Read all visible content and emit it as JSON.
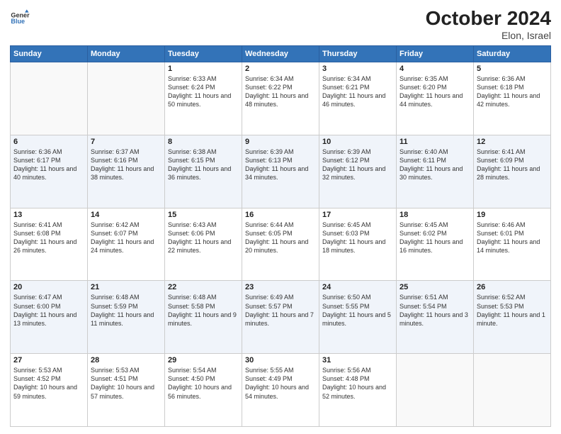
{
  "header": {
    "logo_line1": "General",
    "logo_line2": "Blue",
    "month_year": "October 2024",
    "location": "Elon, Israel"
  },
  "weekdays": [
    "Sunday",
    "Monday",
    "Tuesday",
    "Wednesday",
    "Thursday",
    "Friday",
    "Saturday"
  ],
  "rows": [
    {
      "cells": [
        {
          "day": "",
          "info": ""
        },
        {
          "day": "",
          "info": ""
        },
        {
          "day": "1",
          "info": "Sunrise: 6:33 AM\nSunset: 6:24 PM\nDaylight: 11 hours and 50 minutes."
        },
        {
          "day": "2",
          "info": "Sunrise: 6:34 AM\nSunset: 6:22 PM\nDaylight: 11 hours and 48 minutes."
        },
        {
          "day": "3",
          "info": "Sunrise: 6:34 AM\nSunset: 6:21 PM\nDaylight: 11 hours and 46 minutes."
        },
        {
          "day": "4",
          "info": "Sunrise: 6:35 AM\nSunset: 6:20 PM\nDaylight: 11 hours and 44 minutes."
        },
        {
          "day": "5",
          "info": "Sunrise: 6:36 AM\nSunset: 6:18 PM\nDaylight: 11 hours and 42 minutes."
        }
      ]
    },
    {
      "cells": [
        {
          "day": "6",
          "info": "Sunrise: 6:36 AM\nSunset: 6:17 PM\nDaylight: 11 hours and 40 minutes."
        },
        {
          "day": "7",
          "info": "Sunrise: 6:37 AM\nSunset: 6:16 PM\nDaylight: 11 hours and 38 minutes."
        },
        {
          "day": "8",
          "info": "Sunrise: 6:38 AM\nSunset: 6:15 PM\nDaylight: 11 hours and 36 minutes."
        },
        {
          "day": "9",
          "info": "Sunrise: 6:39 AM\nSunset: 6:13 PM\nDaylight: 11 hours and 34 minutes."
        },
        {
          "day": "10",
          "info": "Sunrise: 6:39 AM\nSunset: 6:12 PM\nDaylight: 11 hours and 32 minutes."
        },
        {
          "day": "11",
          "info": "Sunrise: 6:40 AM\nSunset: 6:11 PM\nDaylight: 11 hours and 30 minutes."
        },
        {
          "day": "12",
          "info": "Sunrise: 6:41 AM\nSunset: 6:09 PM\nDaylight: 11 hours and 28 minutes."
        }
      ]
    },
    {
      "cells": [
        {
          "day": "13",
          "info": "Sunrise: 6:41 AM\nSunset: 6:08 PM\nDaylight: 11 hours and 26 minutes."
        },
        {
          "day": "14",
          "info": "Sunrise: 6:42 AM\nSunset: 6:07 PM\nDaylight: 11 hours and 24 minutes."
        },
        {
          "day": "15",
          "info": "Sunrise: 6:43 AM\nSunset: 6:06 PM\nDaylight: 11 hours and 22 minutes."
        },
        {
          "day": "16",
          "info": "Sunrise: 6:44 AM\nSunset: 6:05 PM\nDaylight: 11 hours and 20 minutes."
        },
        {
          "day": "17",
          "info": "Sunrise: 6:45 AM\nSunset: 6:03 PM\nDaylight: 11 hours and 18 minutes."
        },
        {
          "day": "18",
          "info": "Sunrise: 6:45 AM\nSunset: 6:02 PM\nDaylight: 11 hours and 16 minutes."
        },
        {
          "day": "19",
          "info": "Sunrise: 6:46 AM\nSunset: 6:01 PM\nDaylight: 11 hours and 14 minutes."
        }
      ]
    },
    {
      "cells": [
        {
          "day": "20",
          "info": "Sunrise: 6:47 AM\nSunset: 6:00 PM\nDaylight: 11 hours and 13 minutes."
        },
        {
          "day": "21",
          "info": "Sunrise: 6:48 AM\nSunset: 5:59 PM\nDaylight: 11 hours and 11 minutes."
        },
        {
          "day": "22",
          "info": "Sunrise: 6:48 AM\nSunset: 5:58 PM\nDaylight: 11 hours and 9 minutes."
        },
        {
          "day": "23",
          "info": "Sunrise: 6:49 AM\nSunset: 5:57 PM\nDaylight: 11 hours and 7 minutes."
        },
        {
          "day": "24",
          "info": "Sunrise: 6:50 AM\nSunset: 5:55 PM\nDaylight: 11 hours and 5 minutes."
        },
        {
          "day": "25",
          "info": "Sunrise: 6:51 AM\nSunset: 5:54 PM\nDaylight: 11 hours and 3 minutes."
        },
        {
          "day": "26",
          "info": "Sunrise: 6:52 AM\nSunset: 5:53 PM\nDaylight: 11 hours and 1 minute."
        }
      ]
    },
    {
      "cells": [
        {
          "day": "27",
          "info": "Sunrise: 5:53 AM\nSunset: 4:52 PM\nDaylight: 10 hours and 59 minutes."
        },
        {
          "day": "28",
          "info": "Sunrise: 5:53 AM\nSunset: 4:51 PM\nDaylight: 10 hours and 57 minutes."
        },
        {
          "day": "29",
          "info": "Sunrise: 5:54 AM\nSunset: 4:50 PM\nDaylight: 10 hours and 56 minutes."
        },
        {
          "day": "30",
          "info": "Sunrise: 5:55 AM\nSunset: 4:49 PM\nDaylight: 10 hours and 54 minutes."
        },
        {
          "day": "31",
          "info": "Sunrise: 5:56 AM\nSunset: 4:48 PM\nDaylight: 10 hours and 52 minutes."
        },
        {
          "day": "",
          "info": ""
        },
        {
          "day": "",
          "info": ""
        }
      ]
    }
  ]
}
